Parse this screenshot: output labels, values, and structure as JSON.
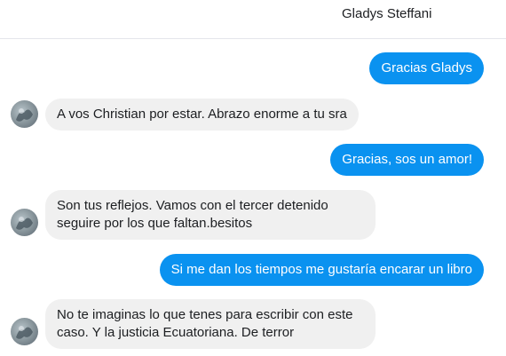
{
  "header": {
    "contact_name": "Gladys Steffani"
  },
  "messages": [
    {
      "side": "out",
      "text": "Gracias Gladys"
    },
    {
      "side": "in",
      "text": "A vos Christian por estar. Abrazo enorme a tu sra"
    },
    {
      "side": "out",
      "text": "Gracias, sos un amor!"
    },
    {
      "side": "in",
      "line1": "Son tus reflejos. Vamos con el tercer detenido",
      "line2": "seguire por los que faltan.besitos"
    },
    {
      "side": "out",
      "text": "Si me dan los tiempos me gustaría encarar un libro"
    },
    {
      "side": "in",
      "line1": "No te imaginas lo que tenes para escribir con este",
      "line2": "caso. Y la justicia Ecuatoriana. De terror"
    }
  ],
  "colors": {
    "outgoing": "#0a92f0",
    "incoming": "#f0f0f0"
  },
  "icons": {
    "avatar": "contact-avatar-photo"
  }
}
